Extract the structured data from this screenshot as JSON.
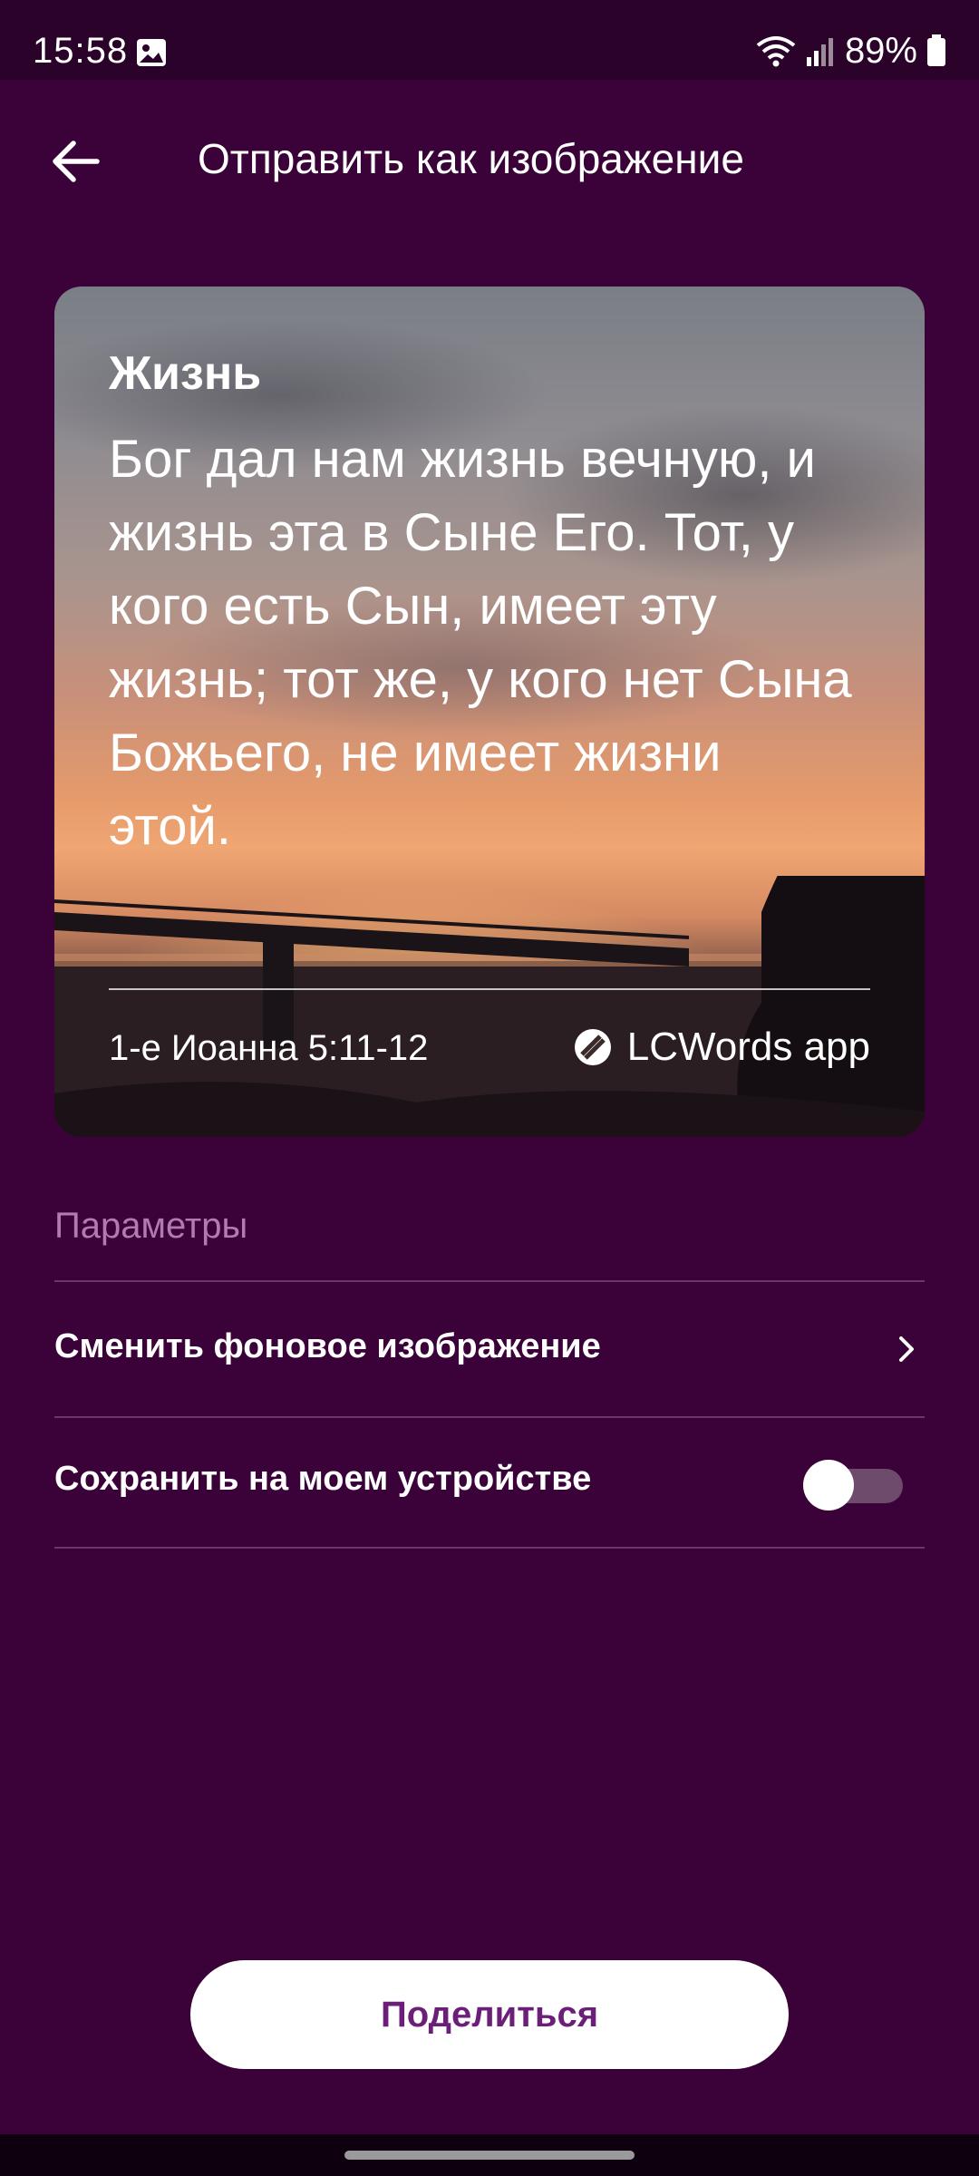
{
  "status_bar": {
    "time": "15:58",
    "battery": "89%",
    "icons": [
      "image-icon",
      "wifi-icon",
      "signal-icon",
      "battery-icon"
    ]
  },
  "app_bar": {
    "title": "Отправить как изображение",
    "back_icon": "arrow-left-icon"
  },
  "card": {
    "title": "Жизнь",
    "verse": "Бог дал нам жизнь вечную, и жизнь эта в Сыне Его. Тот, у кого есть Сын, имеет эту жизнь; тот же, у кого нет Сына Божьего, не имеет жизни этой.",
    "reference": "1-е Иоанна 5:11-12",
    "brand": "LCWords app"
  },
  "settings": {
    "section_label": "Параметры",
    "change_background_label": "Сменить фоновое изображение",
    "save_device_label": "Сохранить на моем устройстве",
    "save_device_enabled": false
  },
  "share_button": {
    "label": "Поделиться"
  },
  "colors": {
    "background": "#3a0238",
    "status_bar": "#2b0229",
    "accent_text": "#6c1f78",
    "section_label": "#b07bb2"
  }
}
